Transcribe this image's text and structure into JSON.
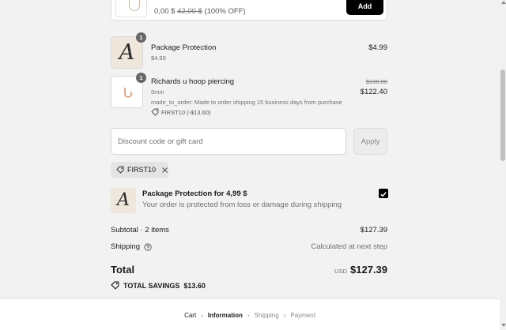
{
  "upsell": {
    "price": "0,00 $",
    "compare_price": "42,00 $",
    "discount": "(100% OFF)",
    "add_label": "Add"
  },
  "line_items": [
    {
      "thumb_letter": "A",
      "quantity": "1",
      "title": "Package Protection",
      "subtitle": "$4.99",
      "price": "$4.99"
    },
    {
      "quantity": "1",
      "title": "Richards u hoop piercing",
      "variant": "5mm",
      "note": "made_to_order: Made to order shipping 15 business days from purchase",
      "discount_code": "FIRST10 (-$13.60)",
      "compare_price": "$136.00",
      "price": "$122.40"
    }
  ],
  "discount": {
    "placeholder": "Discount code or gift card",
    "apply_label": "Apply",
    "applied_code": "FIRST10"
  },
  "protection": {
    "thumb_letter": "A",
    "title": "Package Protection for 4,99 $",
    "description": "Your order is protected from loss or damage during shipping",
    "checked": true
  },
  "summary": {
    "subtotal_label": "Subtotal · 2 items",
    "subtotal_value": "$127.39",
    "shipping_label": "Shipping",
    "shipping_value": "Calculated at next step",
    "total_label": "Total",
    "currency": "USD",
    "total_value": "$127.39",
    "savings_label": "TOTAL SAVINGS",
    "savings_value": "$13.60"
  },
  "breadcrumb": [
    {
      "label": "Cart",
      "state": "done"
    },
    {
      "label": "Information",
      "state": "current"
    },
    {
      "label": "Shipping",
      "state": "future"
    },
    {
      "label": "Payment",
      "state": "future"
    }
  ],
  "colors": {
    "background": "#f2f2f2",
    "button_dark": "#000000",
    "muted_text": "#707070"
  }
}
